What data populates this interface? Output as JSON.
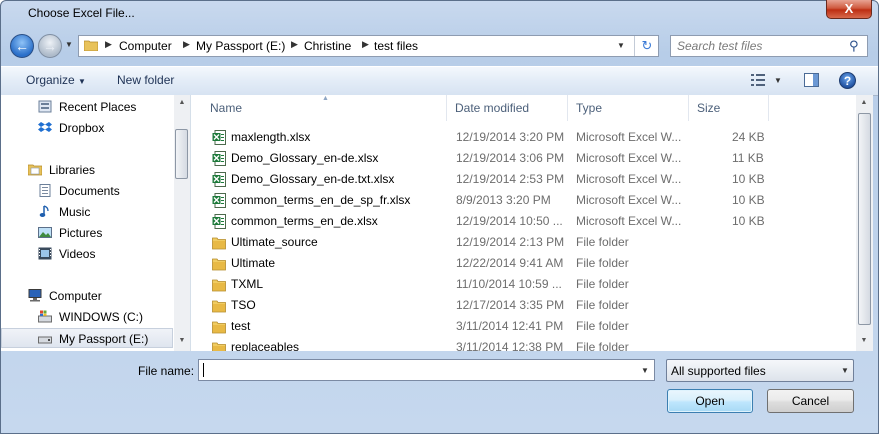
{
  "window": {
    "title": "Choose Excel File...",
    "close_label": "X"
  },
  "address": {
    "crumbs": [
      "Computer",
      "My Passport (E:)",
      "Christine",
      "test files"
    ]
  },
  "search": {
    "placeholder": "Search test files"
  },
  "toolbar": {
    "organize_label": "Organize",
    "new_folder_label": "New folder"
  },
  "nav": {
    "items": [
      {
        "label": "Recent Places",
        "icon": "recent-places-icon"
      },
      {
        "label": "Dropbox",
        "icon": "dropbox-icon"
      },
      {
        "label": "Libraries",
        "icon": "libraries-icon"
      },
      {
        "label": "Documents",
        "icon": "documents-icon"
      },
      {
        "label": "Music",
        "icon": "music-icon"
      },
      {
        "label": "Pictures",
        "icon": "pictures-icon"
      },
      {
        "label": "Videos",
        "icon": "videos-icon"
      },
      {
        "label": "Computer",
        "icon": "computer-icon"
      },
      {
        "label": "WINDOWS (C:)",
        "icon": "drive-c-icon"
      },
      {
        "label": "My Passport (E:)",
        "icon": "external-drive-icon"
      }
    ]
  },
  "columns": {
    "name": "Name",
    "date": "Date modified",
    "type": "Type",
    "size": "Size"
  },
  "files": [
    {
      "name": "maxlength.xlsx",
      "date": "12/19/2014 3:20 PM",
      "type": "Microsoft Excel W...",
      "size": "24 KB",
      "kind": "excel"
    },
    {
      "name": "Demo_Glossary_en-de.xlsx",
      "date": "12/19/2014 3:06 PM",
      "type": "Microsoft Excel W...",
      "size": "11 KB",
      "kind": "excel"
    },
    {
      "name": "Demo_Glossary_en-de.txt.xlsx",
      "date": "12/19/2014 2:53 PM",
      "type": "Microsoft Excel W...",
      "size": "10 KB",
      "kind": "excel"
    },
    {
      "name": "common_terms_en_de_sp_fr.xlsx",
      "date": "8/9/2013 3:20 PM",
      "type": "Microsoft Excel W...",
      "size": "10 KB",
      "kind": "excel"
    },
    {
      "name": "common_terms_en_de.xlsx",
      "date": "12/19/2014 10:50 ...",
      "type": "Microsoft Excel W...",
      "size": "10 KB",
      "kind": "excel"
    },
    {
      "name": "Ultimate_source",
      "date": "12/19/2014 2:13 PM",
      "type": "File folder",
      "size": "",
      "kind": "folder"
    },
    {
      "name": "Ultimate",
      "date": "12/22/2014 9:41 AM",
      "type": "File folder",
      "size": "",
      "kind": "folder"
    },
    {
      "name": "TXML",
      "date": "11/10/2014 10:59 ...",
      "type": "File folder",
      "size": "",
      "kind": "folder"
    },
    {
      "name": "TSO",
      "date": "12/17/2014 3:35 PM",
      "type": "File folder",
      "size": "",
      "kind": "folder"
    },
    {
      "name": "test",
      "date": "3/11/2014 12:41 PM",
      "type": "File folder",
      "size": "",
      "kind": "folder"
    },
    {
      "name": "replaceables",
      "date": "3/11/2014 12:38 PM",
      "type": "File folder",
      "size": "",
      "kind": "folder"
    }
  ],
  "bottom": {
    "file_name_label": "File name:",
    "file_name_value": "",
    "file_type_selected": "All supported files",
    "open_label": "Open",
    "cancel_label": "Cancel"
  },
  "colors": {
    "frame": "#b7cde8",
    "close": "#c7391c",
    "excel": "#1d7a3a",
    "folder": "#e8c25a"
  }
}
